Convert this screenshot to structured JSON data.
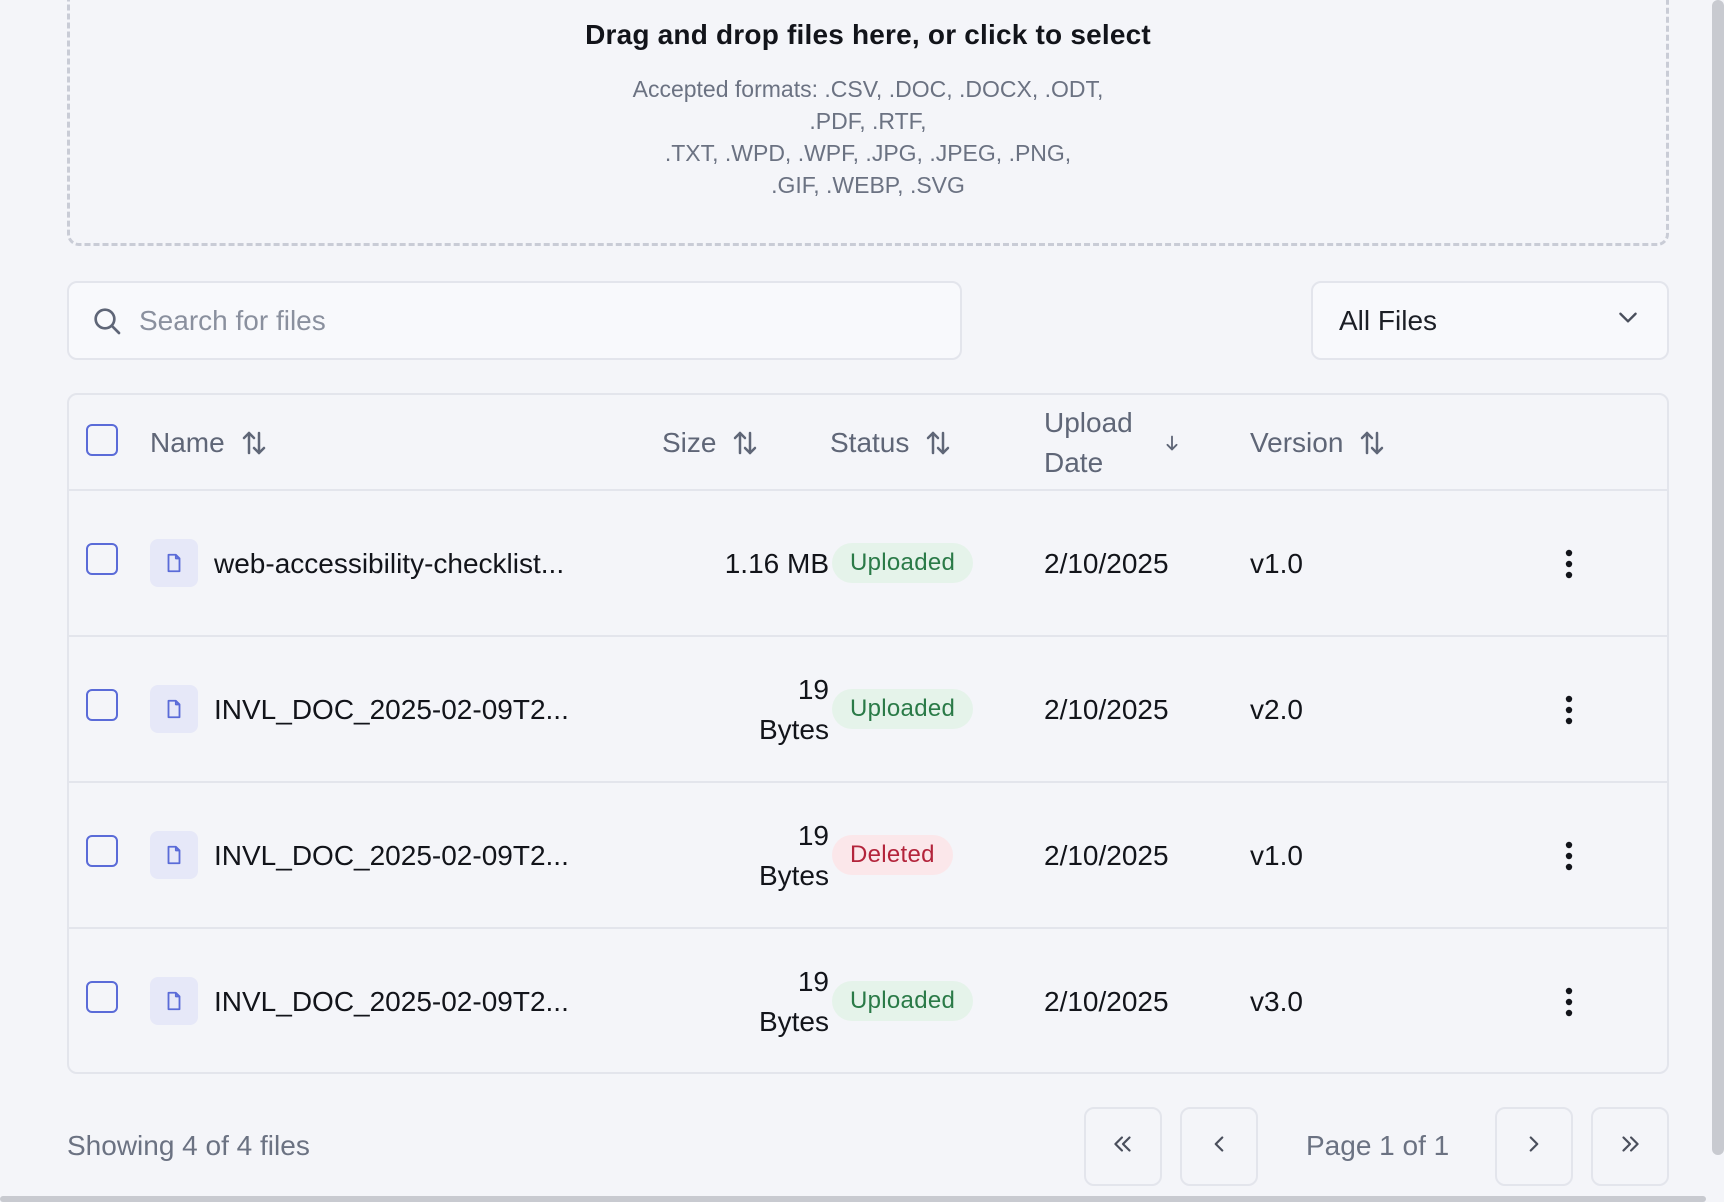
{
  "dropzone": {
    "title": "Drag and drop files here, or click to select",
    "formats_line1": "Accepted formats: .CSV, .DOC, .DOCX, .ODT,",
    "formats_line2": ".PDF, .RTF,",
    "formats_line3": ".TXT, .WPD, .WPF, .JPG, .JPEG, .PNG,",
    "formats_line4": ".GIF, .WEBP, .SVG"
  },
  "search": {
    "placeholder": "Search for files",
    "value": ""
  },
  "filter": {
    "selected": "All Files"
  },
  "table": {
    "headers": {
      "name": "Name",
      "size": "Size",
      "status": "Status",
      "upload_date_line1": "Upload",
      "upload_date_line2": "Date",
      "version": "Version"
    },
    "rows": [
      {
        "name": "web-accessibility-checklist...",
        "size_line1": "1.16 MB",
        "size_line2": "",
        "status": "Uploaded",
        "status_kind": "uploaded",
        "date": "2/10/2025",
        "version": "v1.0"
      },
      {
        "name": "INVL_DOC_2025-02-09T2...",
        "size_line1": "19",
        "size_line2": "Bytes",
        "status": "Uploaded",
        "status_kind": "uploaded",
        "date": "2/10/2025",
        "version": "v2.0"
      },
      {
        "name": "INVL_DOC_2025-02-09T2...",
        "size_line1": "19",
        "size_line2": "Bytes",
        "status": "Deleted",
        "status_kind": "deleted",
        "date": "2/10/2025",
        "version": "v1.0"
      },
      {
        "name": "INVL_DOC_2025-02-09T2...",
        "size_line1": "19",
        "size_line2": "Bytes",
        "status": "Uploaded",
        "status_kind": "uploaded",
        "date": "2/10/2025",
        "version": "v3.0"
      }
    ]
  },
  "footer": {
    "showing": "Showing 4 of 4 files",
    "page_label": "Page 1 of 1"
  },
  "colors": {
    "accent": "#5a6bd8",
    "uploaded_bg": "#e5f3ea",
    "uploaded_fg": "#2a7a47",
    "deleted_bg": "#fbe7ea",
    "deleted_fg": "#b3243b"
  }
}
